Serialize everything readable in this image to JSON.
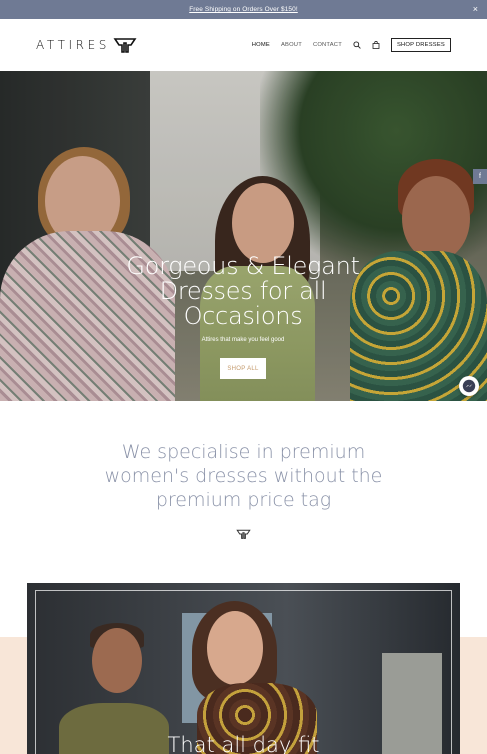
{
  "announcement": {
    "text": "Free Shipping on Orders Over $150!",
    "close": "×"
  },
  "header": {
    "logo_text": "ATTIRES",
    "nav": [
      {
        "label": "HOME"
      },
      {
        "label": "ABOUT"
      },
      {
        "label": "CONTACT"
      }
    ],
    "cta": "SHOP DRESSES"
  },
  "hero": {
    "title": "Gorgeous & Elegant Dresses for all Occasions",
    "subtitle": "Attires that make you feel good",
    "button": "SHOP ALL",
    "social_fb": "f"
  },
  "tagline": {
    "text": "We specialise in premium women's dresses without the premium price tag"
  },
  "feature": {
    "title": "That all day fit"
  },
  "colors": {
    "announcement_bg": "#6f7a94",
    "tagline": "#8a92a8",
    "band": "#f8e6d8",
    "button_text": "#c49a6c"
  },
  "icons": [
    "logo-mark-icon",
    "search-icon",
    "cart-icon",
    "facebook-icon",
    "messenger-icon",
    "close-icon"
  ]
}
